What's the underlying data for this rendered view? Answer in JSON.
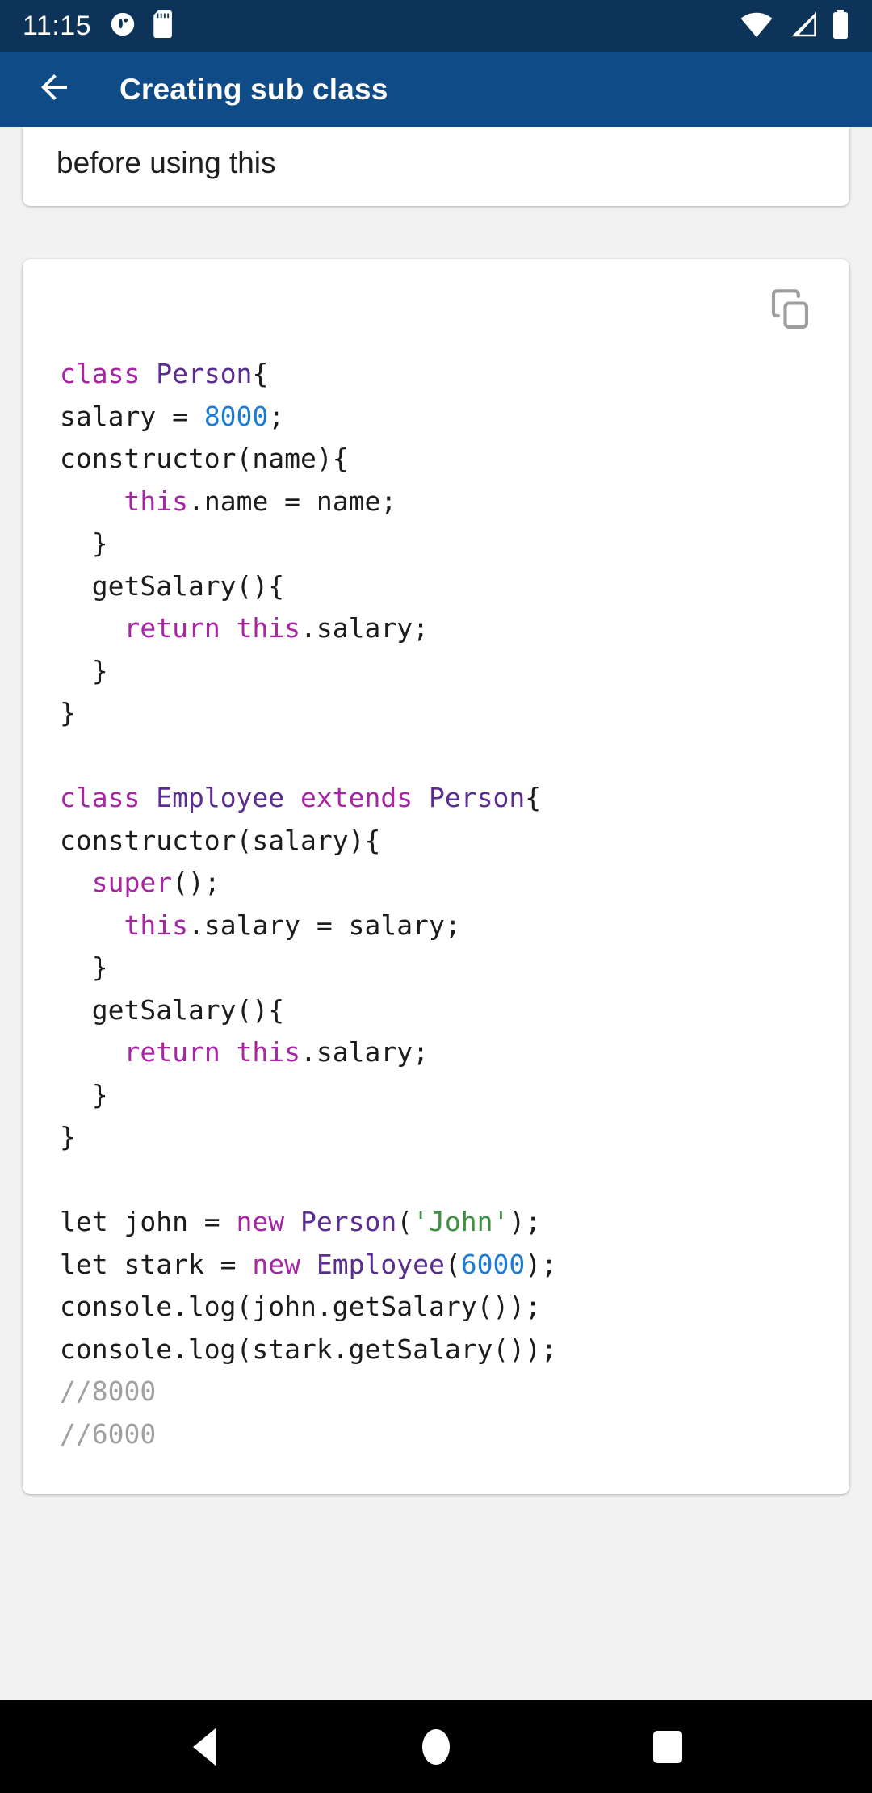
{
  "status_bar": {
    "time": "11:15",
    "left_icons": [
      "app-notification-icon",
      "sd-card-icon"
    ],
    "right_icons": [
      "wifi-icon",
      "cellular-signal-icon",
      "battery-icon"
    ],
    "background_color": "#0d3458",
    "foreground_color": "#ffffff"
  },
  "app_bar": {
    "title": "Creating sub class",
    "back_icon": "arrow-left-icon",
    "background_color": "#0f4c87",
    "foreground_color": "#ffffff"
  },
  "text_card": {
    "paragraph": "before using this"
  },
  "code_card": {
    "copy_icon": "copy-icon",
    "copy_icon_color": "#9e9e9e",
    "lines": [
      [
        {
          "t": "class ",
          "c": "kw"
        },
        {
          "t": "Person",
          "c": "typ"
        },
        {
          "t": "{",
          "c": ""
        }
      ],
      [
        {
          "t": "salary = ",
          "c": ""
        },
        {
          "t": "8000",
          "c": "num"
        },
        {
          "t": ";",
          "c": ""
        }
      ],
      [
        {
          "t": "constructor(name){",
          "c": ""
        }
      ],
      [
        {
          "t": "    ",
          "c": ""
        },
        {
          "t": "this",
          "c": "kw"
        },
        {
          "t": ".name = name;",
          "c": ""
        }
      ],
      [
        {
          "t": "  }",
          "c": ""
        }
      ],
      [
        {
          "t": "  getSalary(){",
          "c": ""
        }
      ],
      [
        {
          "t": "    ",
          "c": ""
        },
        {
          "t": "return ",
          "c": "kw"
        },
        {
          "t": "this",
          "c": "kw"
        },
        {
          "t": ".salary;",
          "c": ""
        }
      ],
      [
        {
          "t": "  }",
          "c": ""
        }
      ],
      [
        {
          "t": "}",
          "c": ""
        }
      ],
      [],
      [
        {
          "t": "class ",
          "c": "kw"
        },
        {
          "t": "Employee ",
          "c": "typ"
        },
        {
          "t": "extends ",
          "c": "kw"
        },
        {
          "t": "Person",
          "c": "typ"
        },
        {
          "t": "{",
          "c": ""
        }
      ],
      [
        {
          "t": "constructor(salary){",
          "c": ""
        }
      ],
      [
        {
          "t": "  ",
          "c": ""
        },
        {
          "t": "super",
          "c": "kw"
        },
        {
          "t": "();",
          "c": ""
        }
      ],
      [
        {
          "t": "    ",
          "c": ""
        },
        {
          "t": "this",
          "c": "kw"
        },
        {
          "t": ".salary = salary;",
          "c": ""
        }
      ],
      [
        {
          "t": "  }",
          "c": ""
        }
      ],
      [
        {
          "t": "  getSalary(){",
          "c": ""
        }
      ],
      [
        {
          "t": "    ",
          "c": ""
        },
        {
          "t": "return ",
          "c": "kw"
        },
        {
          "t": "this",
          "c": "kw"
        },
        {
          "t": ".salary;",
          "c": ""
        }
      ],
      [
        {
          "t": "  }",
          "c": ""
        }
      ],
      [
        {
          "t": "}",
          "c": ""
        }
      ],
      [],
      [
        {
          "t": "let john = ",
          "c": ""
        },
        {
          "t": "new ",
          "c": "kw"
        },
        {
          "t": "Person",
          "c": "typ"
        },
        {
          "t": "(",
          "c": ""
        },
        {
          "t": "'John'",
          "c": "str"
        },
        {
          "t": ");",
          "c": ""
        }
      ],
      [
        {
          "t": "let stark = ",
          "c": ""
        },
        {
          "t": "new ",
          "c": "kw"
        },
        {
          "t": "Employee",
          "c": "typ"
        },
        {
          "t": "(",
          "c": ""
        },
        {
          "t": "6000",
          "c": "num"
        },
        {
          "t": ");",
          "c": ""
        }
      ],
      [
        {
          "t": "console.log(john.getSalary());",
          "c": ""
        }
      ],
      [
        {
          "t": "console.log(stark.getSalary());",
          "c": ""
        }
      ],
      [
        {
          "t": "//8000",
          "c": "com"
        }
      ],
      [
        {
          "t": "//6000",
          "c": "com"
        }
      ]
    ],
    "syntax_colors": {
      "keyword": "#a626a4",
      "type": "#5b2d90",
      "number": "#1c7cd6",
      "string": "#3f9142",
      "comment": "#a0a0a0",
      "plain": "#1c1c1c"
    }
  },
  "nav_bar": {
    "items": [
      {
        "name": "nav-back-button",
        "icon": "triangle-back-icon"
      },
      {
        "name": "nav-home-button",
        "icon": "circle-home-icon"
      },
      {
        "name": "nav-recents-button",
        "icon": "square-recents-icon"
      }
    ],
    "background_color": "#000000"
  }
}
